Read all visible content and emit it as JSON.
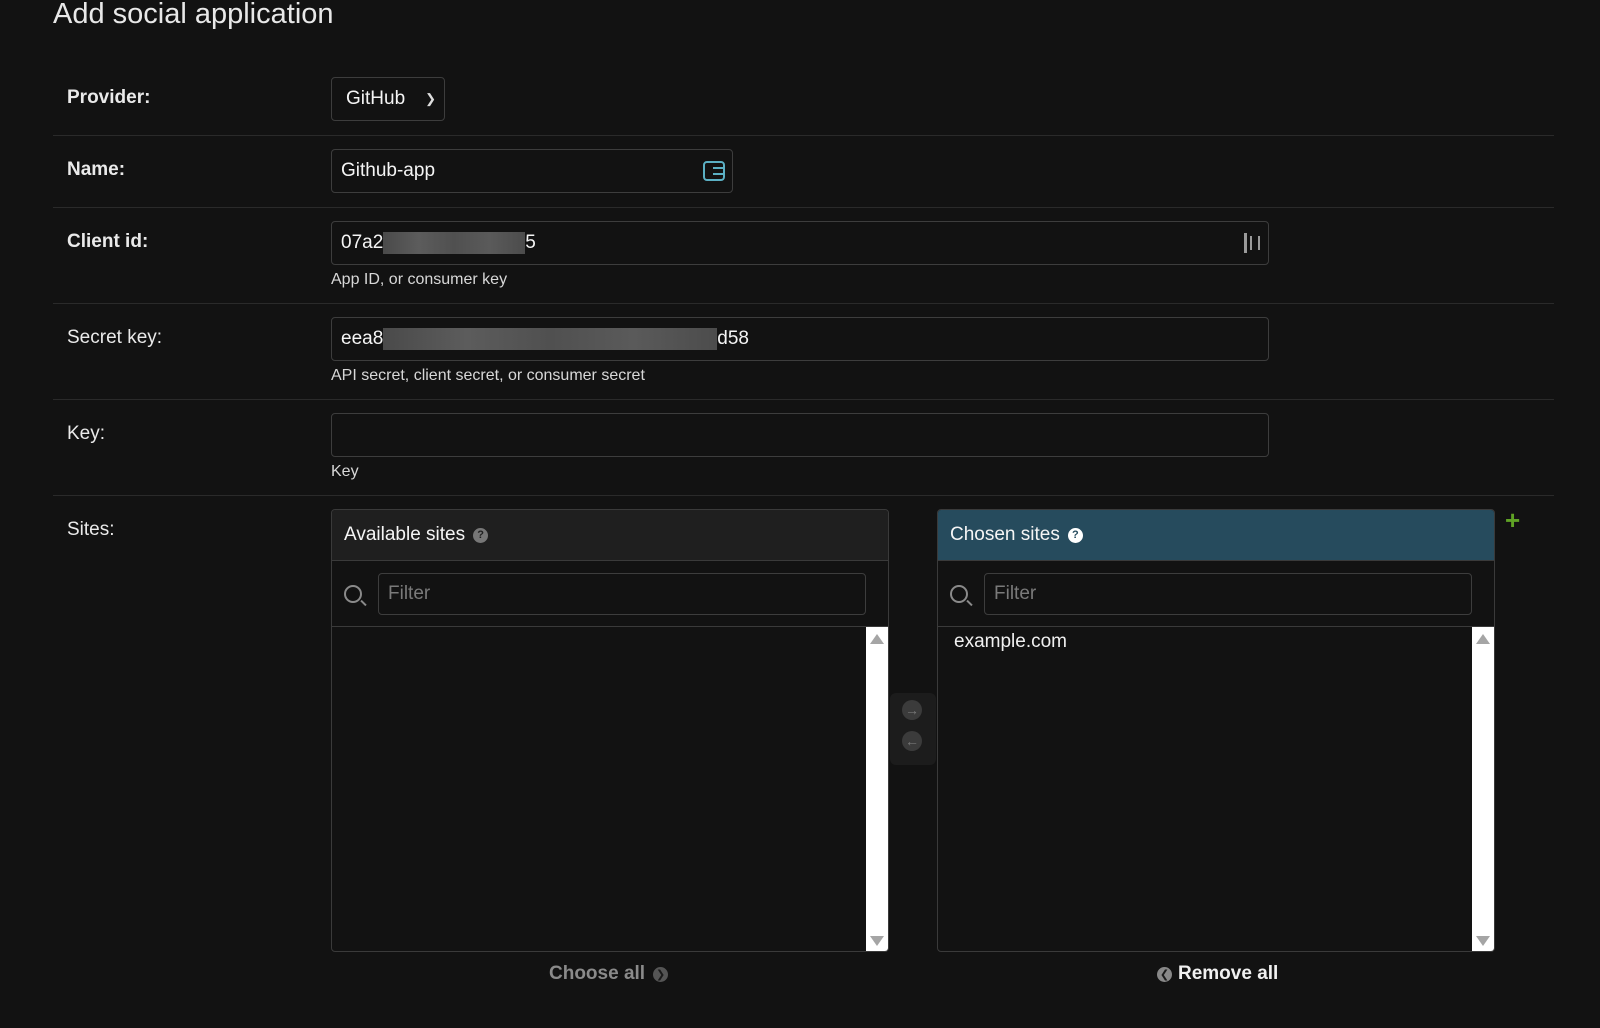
{
  "page": {
    "title": "Add social application"
  },
  "provider": {
    "label": "Provider:",
    "value": "GitHub"
  },
  "name": {
    "label": "Name:",
    "value": "Github-app"
  },
  "client_id": {
    "label": "Client id:",
    "prefix": "07a2",
    "suffix": "5",
    "help": "App ID, or consumer key"
  },
  "secret_key": {
    "label": "Secret key:",
    "prefix": "eea8",
    "suffix": "d58",
    "help": "API secret, client secret, or consumer secret"
  },
  "key": {
    "label": "Key:",
    "value": "",
    "help": "Key"
  },
  "sites": {
    "label": "Sites:",
    "available": {
      "title": "Available sites",
      "filter_placeholder": "Filter",
      "options": []
    },
    "chosen": {
      "title": "Chosen sites",
      "filter_placeholder": "Filter",
      "options": [
        "example.com"
      ]
    },
    "choose_all": "Choose all",
    "remove_all": "Remove all",
    "add_related": "+"
  },
  "colors": {
    "chosen_header": "#264b5d",
    "add_related": "#5fa225",
    "background": "#121212"
  }
}
